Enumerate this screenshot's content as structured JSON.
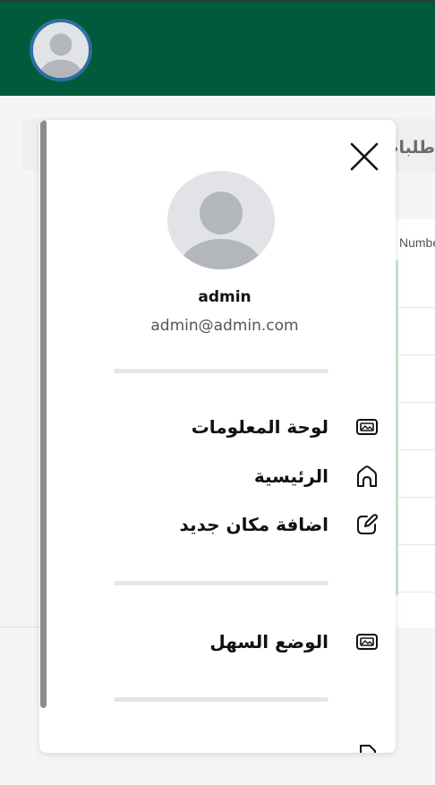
{
  "colors": {
    "header_bg": "#005a3c",
    "avatar_ring": "#2f6f9f",
    "row_accent": "#c7ead0"
  },
  "header": {
    "avatar_icon": "user-avatar-icon"
  },
  "background": {
    "title_partial": "طلبات",
    "column_header_partial": "Number"
  },
  "drawer": {
    "close_icon": "close-icon",
    "profile": {
      "avatar_icon": "user-avatar-icon",
      "name": "admin",
      "email": "admin@admin.com"
    },
    "menu": [
      {
        "label": "لوحة المعلومات",
        "icon": "image-icon"
      },
      {
        "label": "الرئيسية",
        "icon": "home-icon"
      },
      {
        "label": "اضافة مكان جديد",
        "icon": "edit-icon"
      }
    ],
    "settings_menu": [
      {
        "label": "الوضع السهل",
        "icon": "image-icon"
      }
    ]
  }
}
